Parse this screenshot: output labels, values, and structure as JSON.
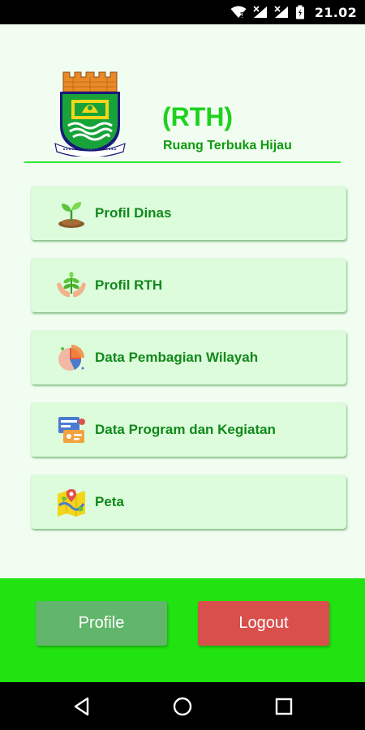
{
  "status_bar": {
    "time": "21.02",
    "icons": [
      "wifi-icon",
      "signal-1-icon",
      "signal-2-icon",
      "battery-icon"
    ]
  },
  "header": {
    "title": "(RTH)",
    "subtitle": "Ruang Terbuka Hijau",
    "logo": "city-emblem-logo"
  },
  "menu": [
    {
      "label": "Profil Dinas",
      "icon": "seedling-icon"
    },
    {
      "label": "Profil RTH",
      "icon": "hands-plant-icon"
    },
    {
      "label": "Data Pembagian Wilayah",
      "icon": "pie-chart-icon"
    },
    {
      "label": "Data Program dan Kegiatan",
      "icon": "program-icon"
    },
    {
      "label": "Peta",
      "icon": "map-icon"
    }
  ],
  "actions": {
    "profile_label": "Profile",
    "logout_label": "Logout"
  },
  "navigation": [
    "back-icon",
    "home-icon",
    "recents-icon"
  ],
  "colors": {
    "accent": "#1fd11f",
    "bottom_panel": "#22e312",
    "profile_button": "#62b66b",
    "logout_button": "#d84f4c",
    "menu_background": "#dcfcdc"
  }
}
